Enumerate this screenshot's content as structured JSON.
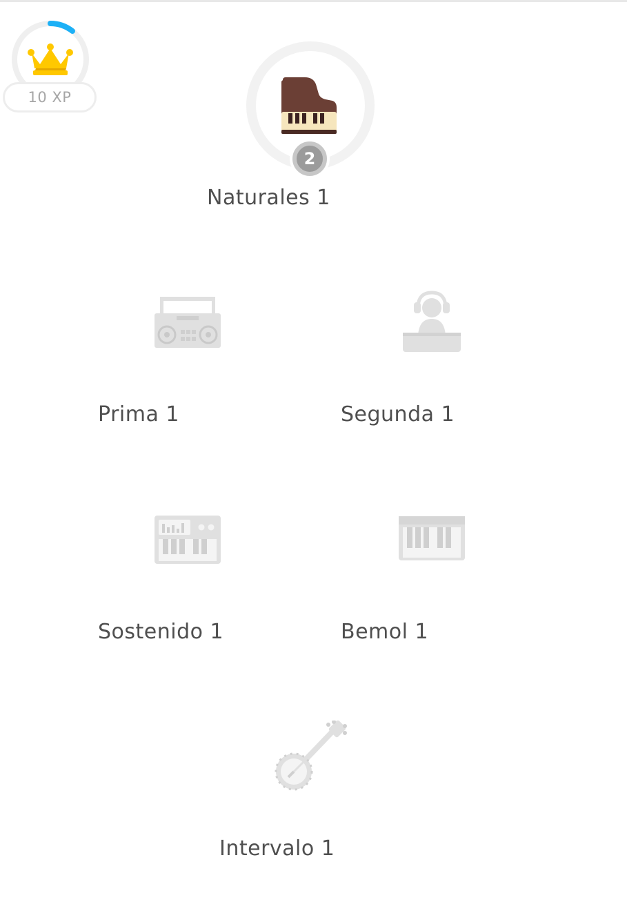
{
  "xp": {
    "label": "10 XP",
    "ring_progress": 0.12,
    "ring_color": "#1cb0f6",
    "crown_color": "#ffc800"
  },
  "skills": {
    "naturales": {
      "label": "Naturales 1",
      "level": "2",
      "icon": "grand-piano-icon",
      "active": true
    },
    "prima": {
      "label": "Prima 1",
      "icon": "boombox-icon",
      "active": false
    },
    "segunda": {
      "label": "Segunda 1",
      "icon": "dj-headphones-icon",
      "active": false
    },
    "sostenido": {
      "label": "Sostenido 1",
      "icon": "synthesizer-icon",
      "active": false
    },
    "bemol": {
      "label": "Bemol 1",
      "icon": "keyboard-icon",
      "active": false
    },
    "intervalo": {
      "label": "Intervalo 1",
      "icon": "banjo-icon",
      "active": false
    }
  },
  "colors": {
    "locked_icon": "#e0e0e0",
    "label_text": "#4f4f4f",
    "piano_body": "#6b3f35"
  }
}
